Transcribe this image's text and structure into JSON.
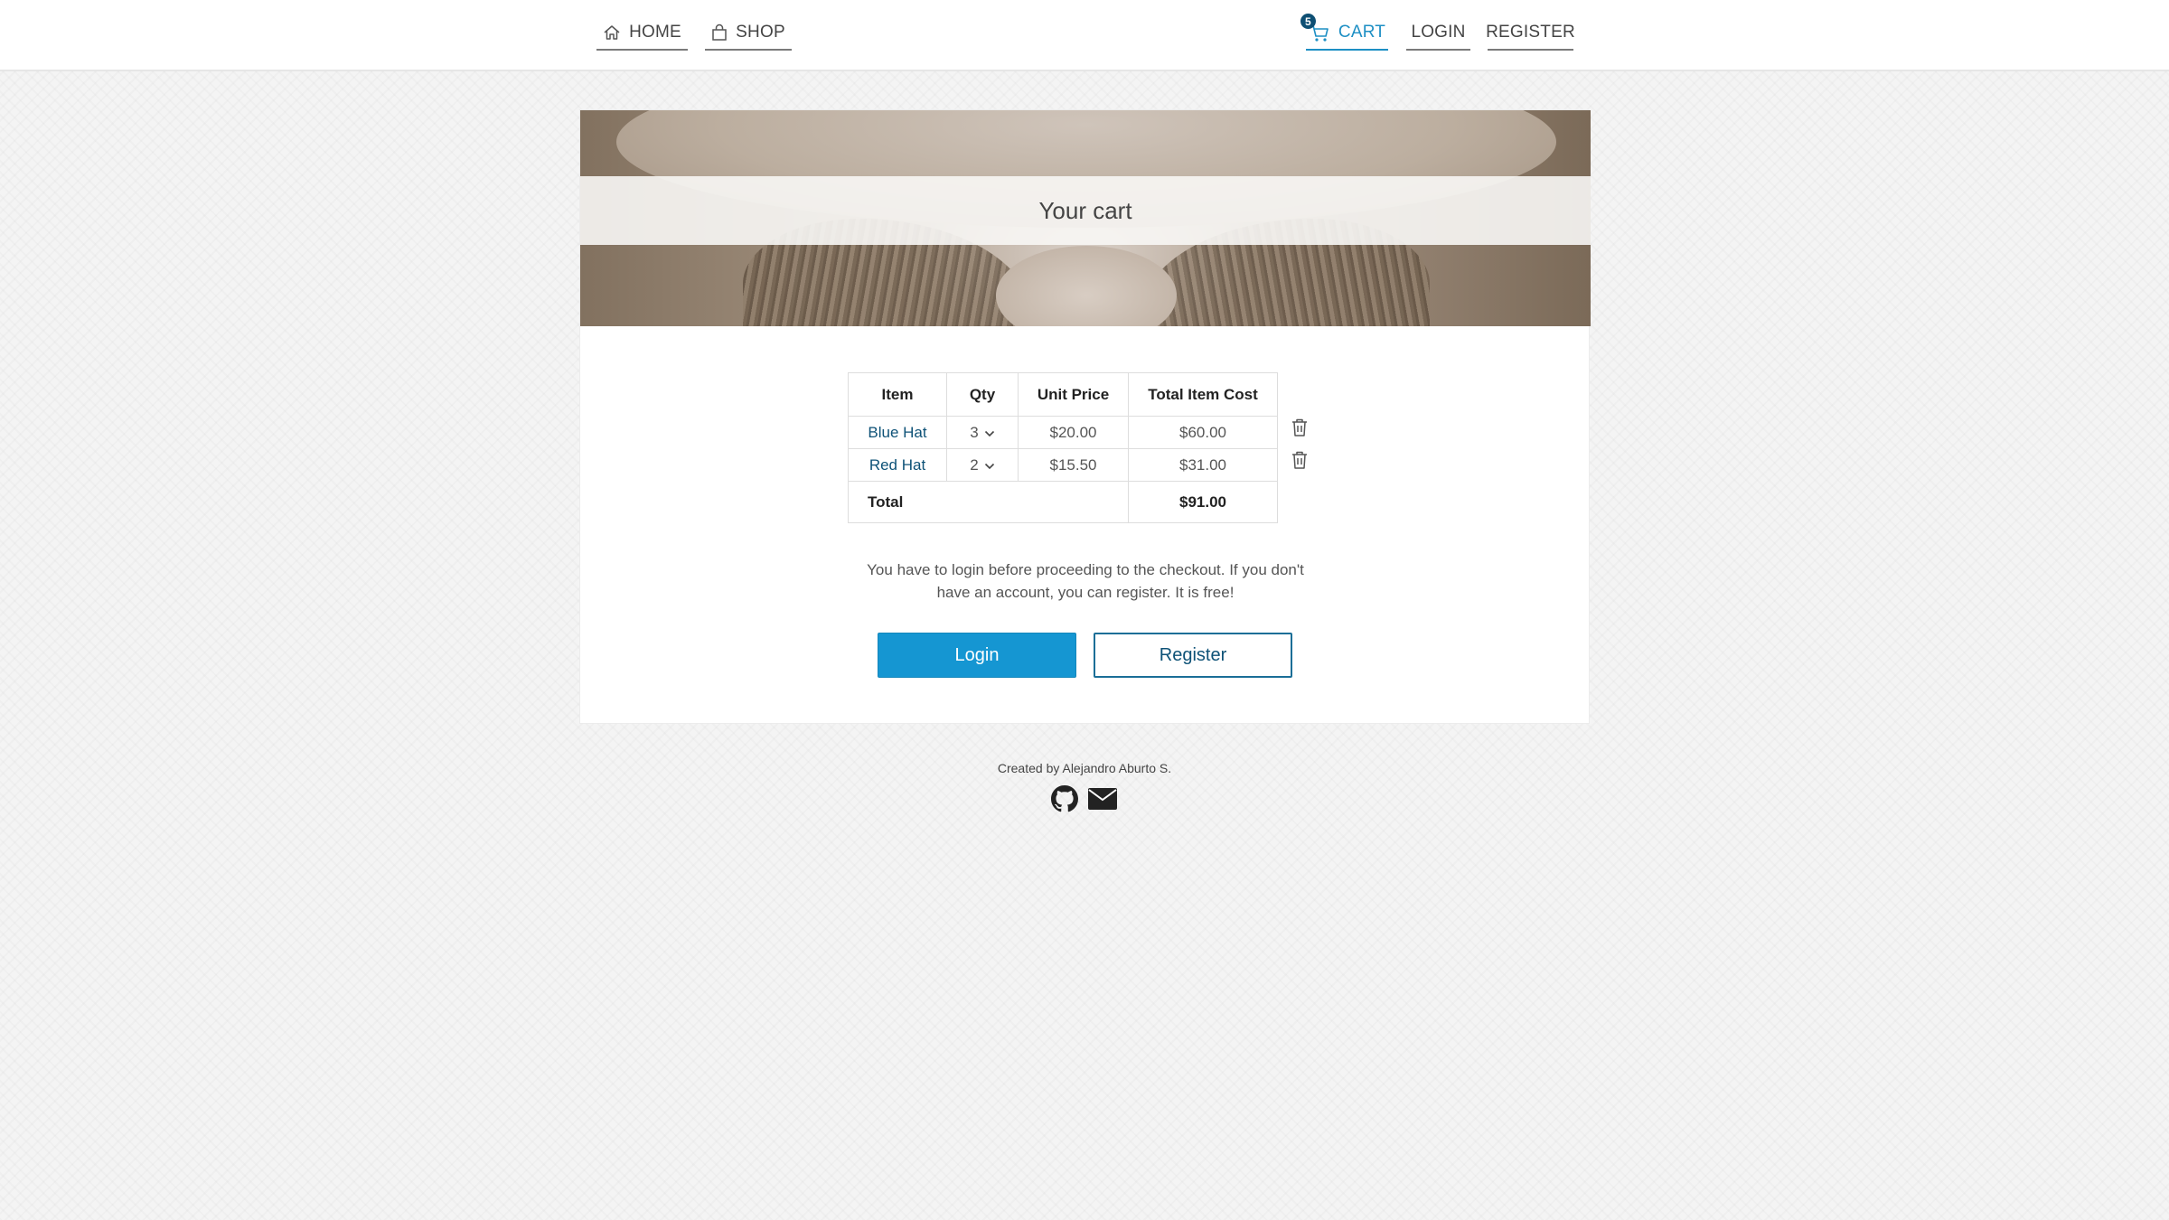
{
  "nav": {
    "home_label": "HOME",
    "shop_label": "SHOP",
    "cart_label": "CART",
    "cart_count": "5",
    "login_label": "LOGIN",
    "register_label": "REGISTER"
  },
  "hero": {
    "title": "Your cart"
  },
  "cart": {
    "headers": [
      "Item",
      "Qty",
      "Unit Price",
      "Total Item Cost"
    ],
    "rows": [
      {
        "item": "Blue Hat",
        "qty": "3",
        "unit_price": "$20.00",
        "total_cost": "$60.00"
      },
      {
        "item": "Red Hat",
        "qty": "2",
        "unit_price": "$15.50",
        "total_cost": "$31.00"
      }
    ],
    "total_label": "Total",
    "total_value": "$91.00"
  },
  "checkout": {
    "note": "You have to login before proceeding to the checkout. If you don't have an account, you can register. It is free!",
    "login_button": "Login",
    "register_button": "Register"
  },
  "footer": {
    "credit": "Created by Alejandro Aburto S."
  },
  "colors": {
    "accent": "#1596d2",
    "link": "#0e5277",
    "badge": "#0e4f73"
  },
  "icons": [
    "home-icon",
    "bag-icon",
    "cart-icon",
    "trash-icon",
    "github-icon",
    "mail-icon",
    "chevron-down-icon"
  ]
}
